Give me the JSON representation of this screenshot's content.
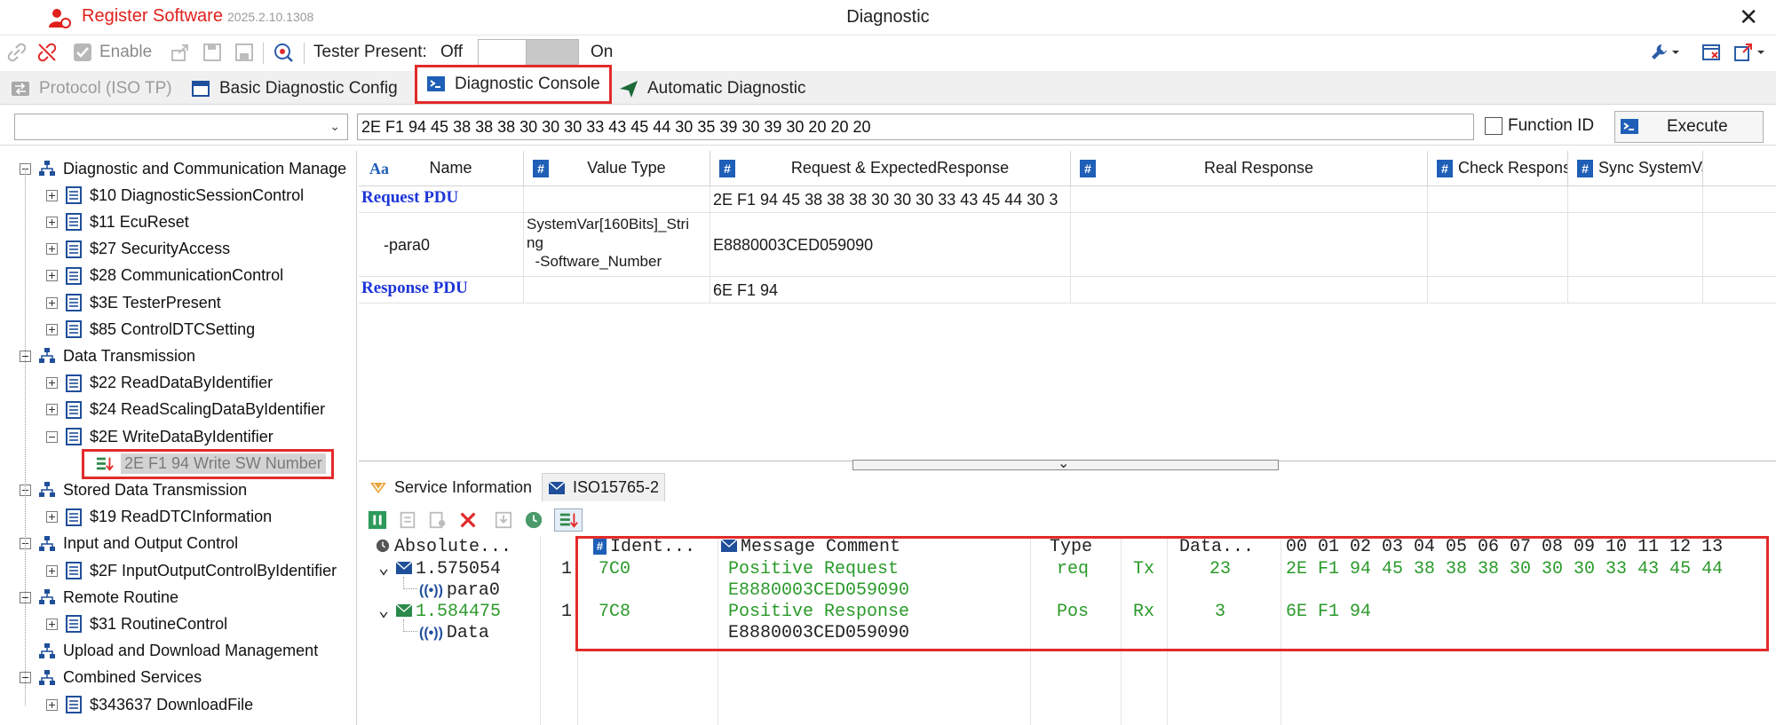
{
  "titlebar": {
    "app_name": "Register Software",
    "version": "2025.2.10.1308",
    "window_title": "Diagnostic",
    "close": "✕"
  },
  "toolbar": {
    "enable_label": "Enable",
    "tester_present_label": "Tester Present:",
    "off_label": "Off",
    "on_label": "On",
    "toggle_state": "off"
  },
  "tabs": [
    {
      "label": "Protocol (ISO TP)",
      "icon": "swap-icon",
      "state": "disabled"
    },
    {
      "label": "Basic Diagnostic Config",
      "icon": "window-icon",
      "state": "normal"
    },
    {
      "label": "Diagnostic Console",
      "icon": "console-icon",
      "state": "active"
    },
    {
      "label": "Automatic Diagnostic",
      "icon": "send-icon",
      "state": "normal"
    }
  ],
  "command": {
    "combo_value": "",
    "request_hex": "2E F1 94 45 38 38 38 30 30 30 33 43 45 44 30 35 39 30 39 30 20 20 20",
    "function_id_label": "Function ID",
    "function_id_checked": false,
    "execute_label": "Execute"
  },
  "tree": [
    {
      "label": "Diagnostic and Communication Manage",
      "level": 0,
      "expander": "minus",
      "icon": "group-icon"
    },
    {
      "label": "$10 DiagnosticSessionControl",
      "level": 1,
      "expander": "plus",
      "icon": "service-icon"
    },
    {
      "label": "$11 EcuReset",
      "level": 1,
      "expander": "plus",
      "icon": "service-icon"
    },
    {
      "label": "$27 SecurityAccess",
      "level": 1,
      "expander": "plus",
      "icon": "service-icon"
    },
    {
      "label": "$28 CommunicationControl",
      "level": 1,
      "expander": "plus",
      "icon": "service-icon"
    },
    {
      "label": "$3E TesterPresent",
      "level": 1,
      "expander": "plus",
      "icon": "service-icon"
    },
    {
      "label": "$85 ControlDTCSetting",
      "level": 1,
      "expander": "plus",
      "icon": "service-icon"
    },
    {
      "label": "Data Transmission",
      "level": 0,
      "expander": "minus",
      "icon": "group-icon"
    },
    {
      "label": "$22 ReadDataByIdentifier",
      "level": 1,
      "expander": "plus",
      "icon": "service-icon"
    },
    {
      "label": "$24 ReadScalingDataByIdentifier",
      "level": 1,
      "expander": "plus",
      "icon": "service-icon"
    },
    {
      "label": "$2E WriteDataByIdentifier",
      "level": 1,
      "expander": "minus",
      "icon": "service-icon"
    },
    {
      "label": "2E F1 94 Write SW Number",
      "level": 2,
      "expander": "none",
      "icon": "command-icon",
      "selected": true
    },
    {
      "label": "Stored Data Transmission",
      "level": 0,
      "expander": "minus",
      "icon": "group-icon"
    },
    {
      "label": "$19 ReadDTCInformation",
      "level": 1,
      "expander": "plus",
      "icon": "service-icon"
    },
    {
      "label": "Input and Output Control",
      "level": 0,
      "expander": "minus",
      "icon": "group-icon"
    },
    {
      "label": "$2F InputOutputControlByIdentifier",
      "level": 1,
      "expander": "plus",
      "icon": "service-icon"
    },
    {
      "label": "Remote Routine",
      "level": 0,
      "expander": "minus",
      "icon": "group-icon"
    },
    {
      "label": "$31 RoutineControl",
      "level": 1,
      "expander": "plus",
      "icon": "service-icon"
    },
    {
      "label": "Upload and Download Management",
      "level": 0,
      "expander": "none",
      "icon": "group-icon"
    },
    {
      "label": "Combined Services",
      "level": 0,
      "expander": "minus",
      "icon": "group-icon"
    },
    {
      "label": "$343637 DownloadFile",
      "level": 1,
      "expander": "plus",
      "icon": "service-icon"
    }
  ],
  "grid": {
    "headers": [
      "Name",
      "Value Type",
      "Request & ExpectedResponse",
      "Real Response",
      "Check Respons",
      "Sync SystemVa"
    ],
    "header_icons": [
      "Aa",
      "#",
      "#",
      "#",
      "#",
      "#"
    ],
    "rows": [
      {
        "name": "Request PDU",
        "value_type": "",
        "request": "2E F1 94 45 38 38 38 30 30 30 33 43 45 44 30 3",
        "real": "",
        "pdu": true
      },
      {
        "name": "-para0",
        "value_type": "SystemVar[160Bits]_Stri\nng\n  -Software_Number",
        "request": "E8880003CED059090",
        "real": "",
        "pdu": false
      },
      {
        "name": "Response PDU",
        "value_type": "",
        "request": "6E F1 94",
        "real": "",
        "pdu": true
      }
    ]
  },
  "bottom_tabs": [
    {
      "label": "Service Information",
      "icon": "info-icon",
      "active": false
    },
    {
      "label": "ISO15765-2",
      "icon": "message-icon",
      "active": true
    }
  ],
  "trace": {
    "headers": {
      "time": "Absolute...",
      "ident": "Ident...",
      "comment": "Message Comment",
      "type": "Type",
      "data_len": "Data...",
      "bytes": "00 01 02 03 04 05 06 07 08 09 10 11 12 13"
    },
    "rows": [
      {
        "time": "1.575054",
        "chan": "1",
        "ident": "7C0",
        "comment": "Positive Request",
        "type": "req",
        "dir": "Tx",
        "dlc": "23",
        "bytes": "2E F1 94 45 38 38 38 30 30 30 33 43 45 44",
        "color": "dark"
      },
      {
        "sub": "para0",
        "value": "E8880003CED059090"
      },
      {
        "time": "1.584475",
        "chan": "1",
        "ident": "7C8",
        "comment": "Positive Response",
        "type": "Pos",
        "dir": "Rx",
        "dlc": "3",
        "bytes": "6E F1 94",
        "color": "green"
      },
      {
        "sub": "Data",
        "value": "E8880003CED059090"
      }
    ]
  },
  "colors": {
    "accent_red": "#e32a2a",
    "pdu_blue": "#1c35d8",
    "positive_green": "#2a9a2a",
    "brand_red": "#e0201c"
  }
}
